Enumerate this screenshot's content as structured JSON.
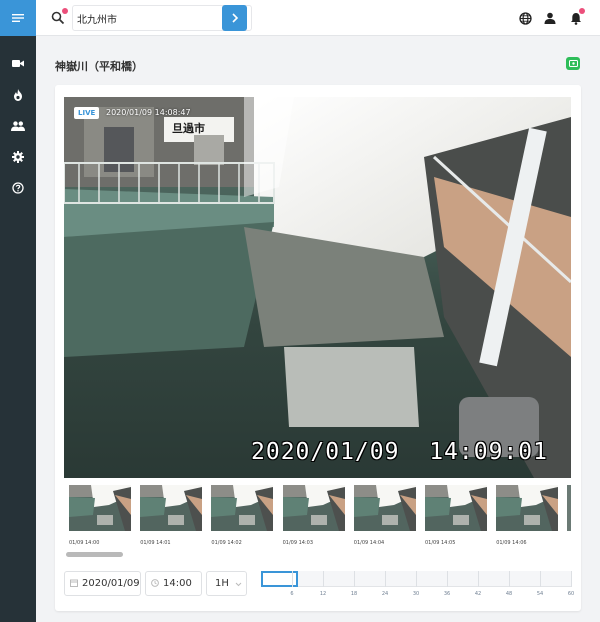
{
  "colors": {
    "accent": "#3a95d8",
    "sidebar_bg": "#263238",
    "notify_dot": "#ec4f7b",
    "action_green": "#2ebd59"
  },
  "sidebar": {
    "menu_icon": "menu-icon",
    "items": [
      {
        "icon": "video-camera-icon"
      },
      {
        "icon": "flame-icon"
      },
      {
        "icon": "people-icon"
      },
      {
        "icon": "gear-icon"
      },
      {
        "icon": "help-icon"
      }
    ]
  },
  "search": {
    "value": "北九州市",
    "placeholder": ""
  },
  "header_icons": [
    "globe-icon",
    "person-icon",
    "bell-icon"
  ],
  "page": {
    "title": "神嶽川（平和橋）"
  },
  "video": {
    "live_label": "LIVE",
    "timestamp": "2020/01/09 14:08:47",
    "overlay_date": "2020/01/09",
    "overlay_time": "14:09:01",
    "sign_text": "旦過市"
  },
  "thumbnails": [
    {
      "label": "01/09 14:00"
    },
    {
      "label": "01/09 14:01"
    },
    {
      "label": "01/09 14:02"
    },
    {
      "label": "01/09 14:03"
    },
    {
      "label": "01/09 14:04"
    },
    {
      "label": "01/09 14:05"
    },
    {
      "label": "01/09 14:06"
    }
  ],
  "controls": {
    "date": "2020/01/09",
    "time": "14:00",
    "range": "1H"
  },
  "timeline": {
    "ticks": [
      "6",
      "12",
      "18",
      "24",
      "30",
      "36",
      "42",
      "48",
      "54",
      "60"
    ]
  }
}
